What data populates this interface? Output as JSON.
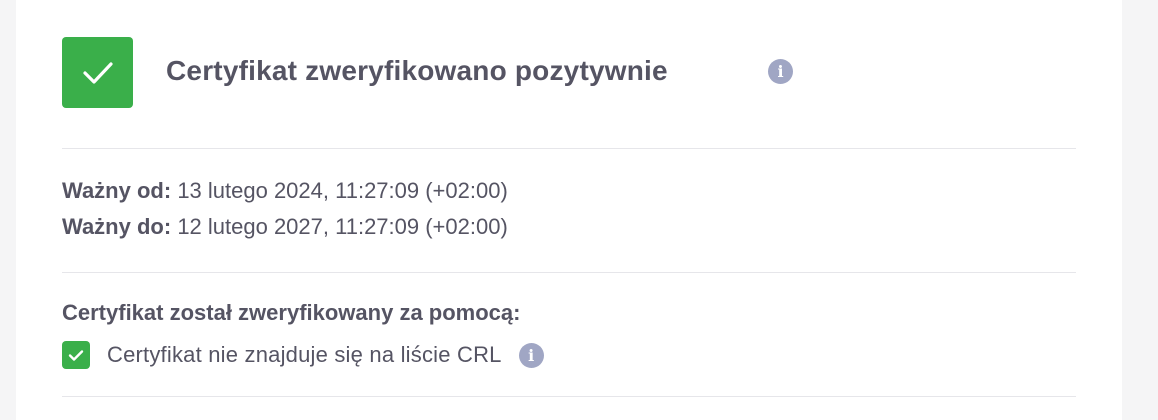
{
  "header": {
    "title": "Certyfikat zweryfikowano pozytywnie",
    "status": "success",
    "status_color": "#3aaf4a",
    "status_icon": "check-icon",
    "info_icon": "info-icon"
  },
  "validity": {
    "from_label": "Ważny od:",
    "from_value": "13 lutego 2024, 11:27:09 (+02:00)",
    "to_label": "Ważny do:",
    "to_value": "12 lutego 2027, 11:27:09 (+02:00)"
  },
  "verification": {
    "heading": "Certyfikat został zweryfikowany za pomocą:",
    "items": [
      {
        "label": "Certyfikat nie znajduje się na liście CRL",
        "checked": true
      }
    ]
  }
}
